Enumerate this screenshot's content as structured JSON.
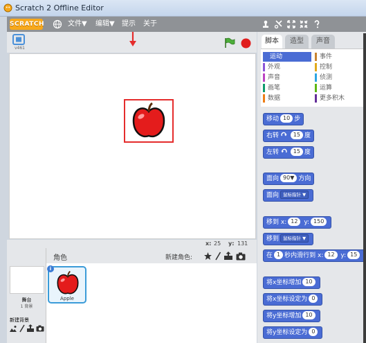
{
  "window": {
    "title": "Scratch 2 Offline Editor"
  },
  "menubar": {
    "logo": "SCRATCH",
    "items": [
      "文件▼",
      "编辑▼",
      "提示",
      "关于"
    ],
    "toolbar_icons": [
      "duplicate-icon",
      "cut-icon",
      "grow-icon",
      "shrink-icon",
      "help-icon"
    ]
  },
  "stage": {
    "version": "v461",
    "coords": {
      "x_label": "x:",
      "x": "25",
      "y_label": "y:",
      "y": "131"
    }
  },
  "sprites": {
    "header": "角色",
    "new_sprite_label": "新建角色:",
    "stage_label": "舞台",
    "backdrops_count": "1 背景",
    "new_backdrop_label": "新建背景",
    "items": [
      {
        "name": "Apple"
      }
    ]
  },
  "tabs": [
    "脚本",
    "造型",
    "声音"
  ],
  "categories": [
    {
      "label": "运动",
      "color": "#4a6cd4",
      "active": true
    },
    {
      "label": "事件",
      "color": "#c88330"
    },
    {
      "label": "外观",
      "color": "#8a55d7"
    },
    {
      "label": "控制",
      "color": "#e1a91a"
    },
    {
      "label": "声音",
      "color": "#bb42c3"
    },
    {
      "label": "侦测",
      "color": "#2ca5e2"
    },
    {
      "label": "画笔",
      "color": "#0e9a6c"
    },
    {
      "label": "运算",
      "color": "#5cb712"
    },
    {
      "label": "数据",
      "color": "#ee7d16"
    },
    {
      "label": "更多积木",
      "color": "#632d99"
    }
  ],
  "blocks": {
    "move": {
      "pre": "移动",
      "val": "10",
      "post": "步"
    },
    "turn_right": {
      "pre": "右转",
      "val": "15",
      "post": "度"
    },
    "turn_left": {
      "pre": "左转",
      "val": "15",
      "post": "度"
    },
    "point_dir": {
      "pre": "面向",
      "val": "90▼",
      "post": "方向"
    },
    "point_towards": {
      "pre": "面向",
      "dd": "鼠标指针 ▼"
    },
    "goto_xy": {
      "pre": "移到",
      "x_label": "x:",
      "x": "12",
      "y_label": "y:",
      "y": "150"
    },
    "goto": {
      "pre": "移到",
      "dd": "鼠标指针 ▼"
    },
    "glide": {
      "pre": "在",
      "secs": "1",
      "mid": "秒内滑行到",
      "x_label": "x:",
      "x": "12",
      "y_label": "y:",
      "y": "15"
    },
    "change_x": {
      "pre": "将x坐标增加",
      "val": "10"
    },
    "set_x": {
      "pre": "将x坐标设定为",
      "val": "0"
    },
    "change_y": {
      "pre": "将y坐标增加",
      "val": "10"
    },
    "set_y": {
      "pre": "将y坐标设定为",
      "val": "0"
    }
  },
  "colors": {
    "accent_red": "#e52c2c",
    "motion": "#4a6cd4",
    "apple_red": "#e41c1c"
  }
}
